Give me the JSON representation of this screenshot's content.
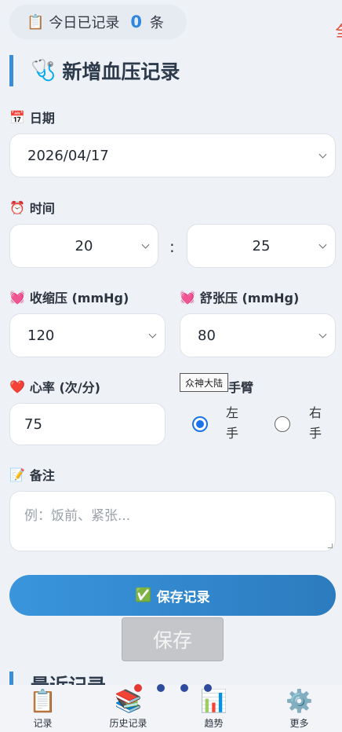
{
  "today": {
    "icon": "clipboard-icon",
    "prefix": "今日已记录",
    "count": "0",
    "suffix": "条"
  },
  "edge_text": "刍",
  "section": {
    "icon": "stethoscope-icon",
    "title": "新增血压记录"
  },
  "fields": {
    "date": {
      "icon": "calendar-icon",
      "label": "日期",
      "value": "2026/04/17"
    },
    "time": {
      "icon": "alarm-clock-icon",
      "label": "时间",
      "hour": "20",
      "separator": ":",
      "minute": "25"
    },
    "systolic": {
      "icon": "heart-icon",
      "label": "收缩压 (mmHg)",
      "value": "120"
    },
    "diastolic": {
      "icon": "heart-icon",
      "label": "舒张压 (mmHg)",
      "value": "80"
    },
    "heart_rate": {
      "icon": "red-heart-icon",
      "label": "心率 (次/分)",
      "value": "75"
    },
    "arm": {
      "label": "手臂",
      "options": [
        "左手",
        "右手"
      ],
      "selected": "左手"
    },
    "note": {
      "icon": "memo-icon",
      "label": "备注",
      "placeholder": "例：饭前、紧张..."
    }
  },
  "tooltip": "众神大陆",
  "buttons": {
    "save_main": "保存记录",
    "save_main_icon": "check-icon",
    "save_secondary": "保存"
  },
  "history_peek": {
    "title": "最近记录"
  },
  "carousel": {
    "count": 4,
    "active": 1
  },
  "tabs": [
    {
      "icon": "clipboard-icon",
      "label": "记录"
    },
    {
      "icon": "books-icon",
      "label": "历史记录"
    },
    {
      "icon": "chart-icon",
      "label": "趋势"
    },
    {
      "icon": "gear-icon",
      "label": "更多"
    }
  ]
}
